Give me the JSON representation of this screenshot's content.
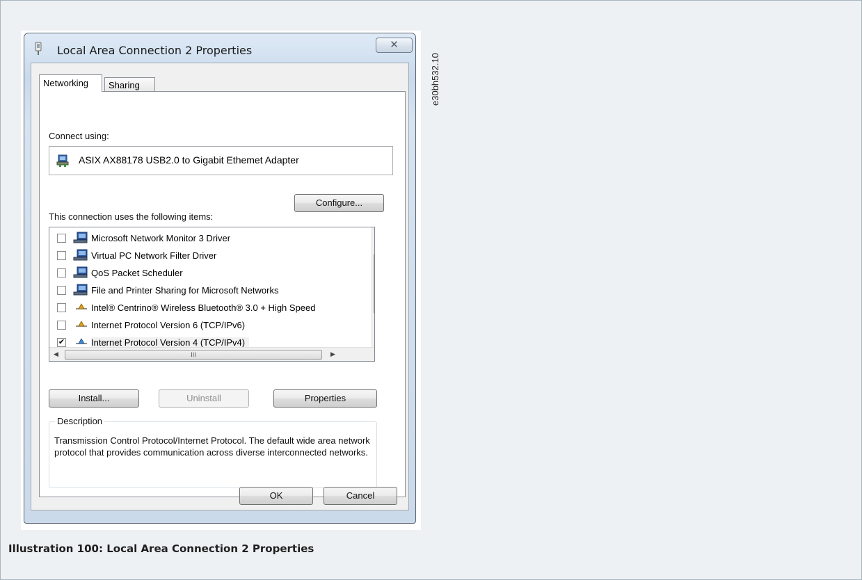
{
  "figure": {
    "id_label": "e30bh532.10",
    "caption": "Illustration 100: Local Area Connection 2 Properties"
  },
  "window": {
    "title": "Local Area Connection 2 Properties",
    "close_symbol": "✕",
    "tabs": [
      {
        "label": "Networking",
        "active": true
      },
      {
        "label": "Sharing",
        "active": false
      }
    ],
    "connect_using_label": "Connect using:",
    "adapter_name": "ASIX AX88178 USB2.0 to Gigabit Ethemet Adapter",
    "adapter_icon": "network-adapter-icon",
    "configure_label": "Configure...",
    "items_label": "This connection uses the following items:",
    "items": [
      {
        "label": "Microsoft Network Monitor 3 Driver",
        "checked": false,
        "icon": "network-client-icon"
      },
      {
        "label": "Virtual PC Network Filter Driver",
        "checked": false,
        "icon": "network-client-icon"
      },
      {
        "label": "QoS Packet Scheduler",
        "checked": false,
        "icon": "network-client-icon"
      },
      {
        "label": "File and Printer Sharing for Microsoft Networks",
        "checked": false,
        "icon": "network-client-icon"
      },
      {
        "label": "Intel® Centrino® Wireless Bluetooth® 3.0 + High Speed",
        "checked": false,
        "icon": "protocol-icon"
      },
      {
        "label": "Internet Protocol Version 6 (TCP/IPv6)",
        "checked": false,
        "icon": "protocol-icon"
      },
      {
        "label": "Internet Protocol Version 4 (TCP/IPv4)",
        "checked": true,
        "icon": "protocol-icon",
        "selected": true
      }
    ],
    "scroll_grip": "≡",
    "hscroll_grip": "III",
    "install_label": "Install...",
    "uninstall_label": "Uninstall",
    "properties_label": "Properties",
    "description_legend": "Description",
    "description_text": "Transmission Control Protocol/Internet Protocol. The default wide area network protocol that provides communication across diverse interconnected networks.",
    "ok_label": "OK",
    "cancel_label": "Cancel"
  },
  "colors": {
    "window_frame": "#cbdaea",
    "client_bg": "#f0f0f0",
    "caption_text": "#1f1f1f"
  }
}
